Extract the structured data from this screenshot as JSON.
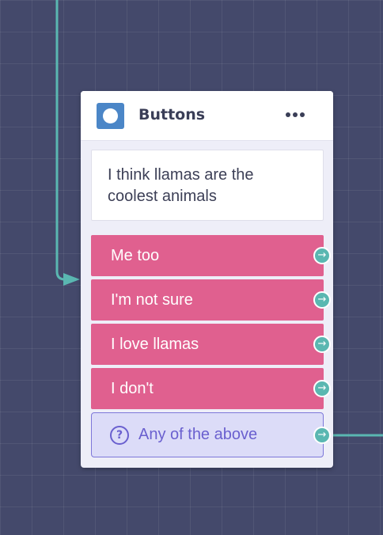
{
  "node": {
    "title": "Buttons",
    "type_icon": "chat-bubble-icon",
    "menu_icon": "more-horizontal-icon",
    "message": "I think llamas are the coolest animals"
  },
  "buttons": [
    {
      "label": "Me too",
      "port_icon": "arrow-right-icon"
    },
    {
      "label": "I'm not sure",
      "port_icon": "arrow-right-icon"
    },
    {
      "label": "I love llamas",
      "port_icon": "arrow-right-icon"
    },
    {
      "label": "I don't",
      "port_icon": "arrow-right-icon"
    }
  ],
  "fallback": {
    "label": "Any of the above",
    "icon": "question-circle-icon",
    "port_icon": "arrow-right-icon"
  },
  "colors": {
    "canvas": "#44496b",
    "connector": "#5ab7b1",
    "button": "#e0608f",
    "fallback_bg": "#dcdcf8",
    "fallback_accent": "#6a60cf",
    "node_icon": "#4b86c7"
  }
}
